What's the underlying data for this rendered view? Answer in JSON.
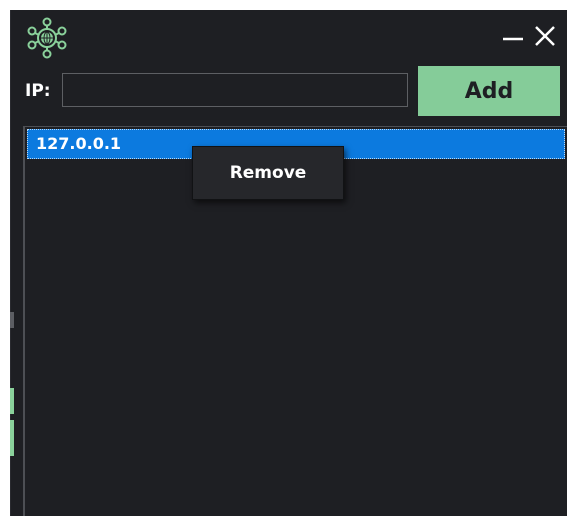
{
  "window": {
    "app_icon": "network-globe-icon",
    "controls": [
      {
        "name": "minimize",
        "icon": "minimize-icon"
      },
      {
        "name": "close",
        "icon": "close-icon"
      }
    ]
  },
  "form": {
    "ip_label": "IP:",
    "ip_value": "",
    "add_label": "Add"
  },
  "list": {
    "items": [
      "127.0.0.1"
    ]
  },
  "context_menu": {
    "items": [
      "Remove"
    ]
  },
  "colors": {
    "background": "#1e1f23",
    "accent_green": "#85cc99",
    "selection_blue": "#0c7adf",
    "text": "#ffffff"
  }
}
